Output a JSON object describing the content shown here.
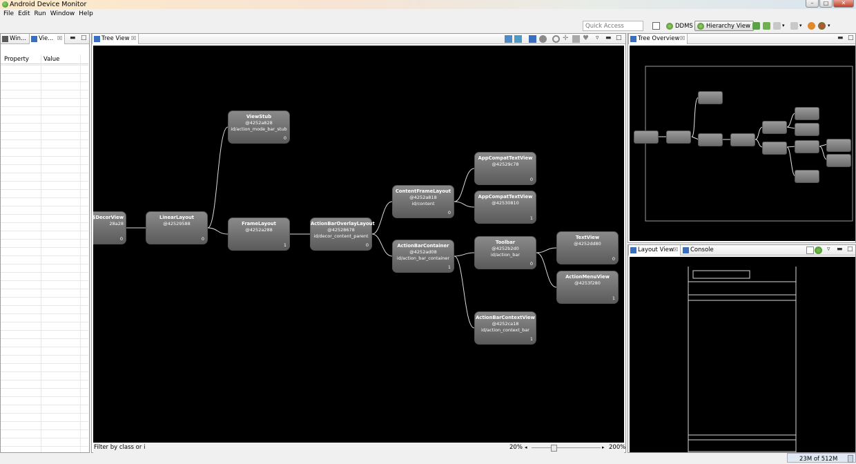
{
  "window": {
    "title": "Android Device Monitor"
  },
  "menu": [
    "File",
    "Edit",
    "Run",
    "Window",
    "Help"
  ],
  "toolbar": {
    "quick_access_placeholder": "Quick Access",
    "perspectives": [
      {
        "label": "DDMS",
        "active": false
      },
      {
        "label": "Hierarchy View",
        "active": true
      }
    ]
  },
  "left_panel": {
    "tabs": [
      {
        "label": "Win..."
      },
      {
        "label": "Vie..."
      }
    ],
    "columns": [
      "Property",
      "Value"
    ]
  },
  "tree_view": {
    "tab_label": "Tree View",
    "nodes": [
      {
        "name": "w$DecorView",
        "addr": "28a28",
        "id": "",
        "index": "0"
      },
      {
        "name": "LinearLayout",
        "addr": "@42529588",
        "id": "",
        "index": "0"
      },
      {
        "name": "ViewStub",
        "addr": "@4252a828",
        "id": "id/action_mode_bar_stub",
        "index": "0"
      },
      {
        "name": "FrameLayout",
        "addr": "@4252a288",
        "id": "",
        "index": "1"
      },
      {
        "name": "ActionBarOverlayLayout",
        "addr": "@42528678",
        "id": "id/decor_content_parent",
        "index": "0"
      },
      {
        "name": "ContentFrameLayout",
        "addr": "@4252a818",
        "id": "id/content",
        "index": "0"
      },
      {
        "name": "ActionBarContainer",
        "addr": "@4252ad08",
        "id": "id/action_bar_container",
        "index": "1"
      },
      {
        "name": "AppCompatTextView",
        "addr": "@42529c78",
        "id": "",
        "index": "0"
      },
      {
        "name": "AppCompatTextView",
        "addr": "@42530810",
        "id": "",
        "index": "1"
      },
      {
        "name": "Toolbar",
        "addr": "@4252b2d0",
        "id": "id/action_bar",
        "index": "0"
      },
      {
        "name": "ActionBarContextView",
        "addr": "@4252ca18",
        "id": "id/action_context_bar",
        "index": "1"
      },
      {
        "name": "TextView",
        "addr": "@4252dd80",
        "id": "",
        "index": "0"
      },
      {
        "name": "ActionMenuView",
        "addr": "@4253f280",
        "id": "",
        "index": "1"
      }
    ],
    "filter_label": "Filter by class or id:",
    "zoom_min": "20%",
    "zoom_max": "200%"
  },
  "tree_overview": {
    "tab_label": "Tree Overview"
  },
  "layout_view": {
    "tab_label": "Layout View",
    "console_tab_label": "Console"
  },
  "status": {
    "heap": "23M of 512M"
  }
}
